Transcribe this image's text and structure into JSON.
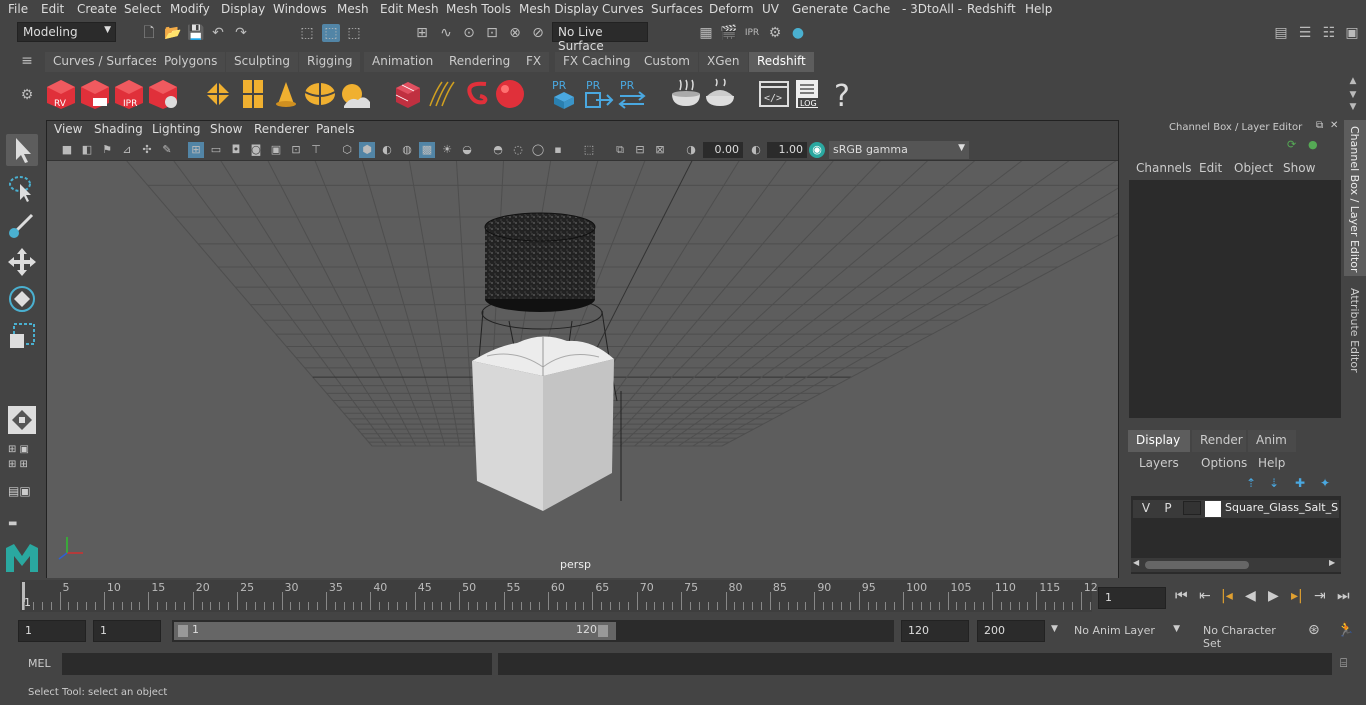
{
  "menu": [
    "File",
    "Edit",
    "Create",
    "Select",
    "Modify",
    "Display",
    "Windows",
    "Mesh",
    "Edit Mesh",
    "Mesh Tools",
    "Mesh Display",
    "Curves",
    "Surfaces",
    "Deform",
    "UV",
    "Generate",
    "Cache",
    "- 3DtoAll -",
    "Redshift",
    "Help"
  ],
  "status": {
    "mode": "Modeling",
    "live_surface": "No Live Surface"
  },
  "shelf_tabs": [
    "Curves / Surfaces",
    "Polygons",
    "Sculpting",
    "Rigging",
    "Animation",
    "Rendering",
    "FX",
    "FX Caching",
    "Custom",
    "XGen",
    "Redshift"
  ],
  "shelf_active": "Redshift",
  "shelf_icons": {
    "rv": "RV",
    "ipr": "IPR",
    "pr": "PR",
    "log": "LOG",
    "help": "?"
  },
  "viewport": {
    "menu": [
      "View",
      "Shading",
      "Lighting",
      "Show",
      "Renderer",
      "Panels"
    ],
    "exposure": "0.00",
    "gamma": "1.00",
    "colorspace": "sRGB gamma",
    "camera": "persp"
  },
  "channel_box": {
    "title": "Channel Box / Layer Editor",
    "menu": [
      "Channels",
      "Edit",
      "Object",
      "Show"
    ],
    "layer_tabs": [
      "Display",
      "Render",
      "Anim"
    ],
    "layer_menu": [
      "Layers",
      "Options",
      "Help"
    ],
    "layer": {
      "v": "V",
      "p": "P",
      "name": "Square_Glass_Salt_Sha"
    }
  },
  "side_tabs": {
    "channel": "Channel Box / Layer Editor",
    "attr": "Attribute Editor"
  },
  "timeline": {
    "ticks": [
      "5",
      "10",
      "15",
      "20",
      "25",
      "30",
      "35",
      "40",
      "45",
      "50",
      "55",
      "60",
      "65",
      "70",
      "75",
      "80",
      "85",
      "90",
      "95",
      "100",
      "105",
      "110",
      "115",
      "12"
    ],
    "start": "1",
    "current": "1"
  },
  "range": {
    "start": "1",
    "current": "1",
    "slider_start": "1",
    "slider_end": "120",
    "end": "120",
    "max": "200",
    "anim_layer": "No Anim Layer",
    "char_set": "No Character Set"
  },
  "mel": {
    "label": "MEL"
  },
  "help": {
    "text": "Select Tool: select an object"
  },
  "colors": {
    "accent": "#5285a6",
    "panel": "#444444",
    "field": "#2b2b2b",
    "redshift": "#e0303a",
    "yellow": "#f0b030"
  }
}
